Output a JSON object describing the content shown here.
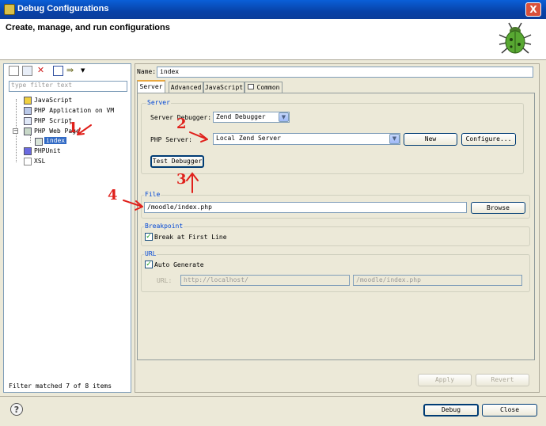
{
  "window": {
    "title": "Debug Configurations",
    "close_symbol": "X"
  },
  "header": {
    "title": "Create, manage, and run configurations",
    "icon": "bug-icon"
  },
  "left": {
    "filter_placeholder": "type filter text",
    "tree": [
      {
        "label": "JavaScript",
        "icon": "javascript-icon"
      },
      {
        "label": "PHP Application on VM",
        "icon": "php-vm-icon"
      },
      {
        "label": "PHP Script",
        "icon": "php-script-icon"
      },
      {
        "label": "PHP Web Page",
        "icon": "php-web-icon",
        "expanded": true
      },
      {
        "label": "index",
        "icon": "file-icon",
        "selected": true
      },
      {
        "label": "PHPUnit",
        "icon": "phpunit-icon"
      },
      {
        "label": "XSL",
        "icon": "xsl-icon"
      }
    ],
    "status": "Filter matched 7 of 8 items"
  },
  "right": {
    "name_label": "Name:",
    "name_value": "index",
    "tabs": [
      "Server",
      "Advanced",
      "JavaScript",
      "Common"
    ],
    "active_tab": "Server",
    "server_group": {
      "title": "Server",
      "debugger_label": "Server Debugger:",
      "debugger_value": "Zend Debugger",
      "php_server_label": "PHP Server:",
      "php_server_value": "Local Zend Server",
      "new_label": "New",
      "configure_label": "Configure...",
      "test_label": "Test Debugger"
    },
    "file_group": {
      "title": "File",
      "value": "/moodle/index.php",
      "browse_label": "Browse"
    },
    "breakpoint_group": {
      "title": "Breakpoint",
      "checkbox_label": "Break at First Line",
      "checked": true
    },
    "url_group": {
      "title": "URL",
      "auto_label": "Auto Generate",
      "checked": true,
      "url_label": "URL:",
      "url_base": "http://localhost/",
      "url_path": "/moodle/index.php"
    },
    "apply_label": "Apply",
    "revert_label": "Revert"
  },
  "footer": {
    "debug_label": "Debug",
    "close_label": "Close",
    "help_symbol": "?"
  },
  "annotations": [
    "1",
    "2",
    "3",
    "4"
  ],
  "colors": {
    "annotation": "#e0201b",
    "title_bar": "#0a5fd8",
    "group_title": "#0046d5"
  }
}
